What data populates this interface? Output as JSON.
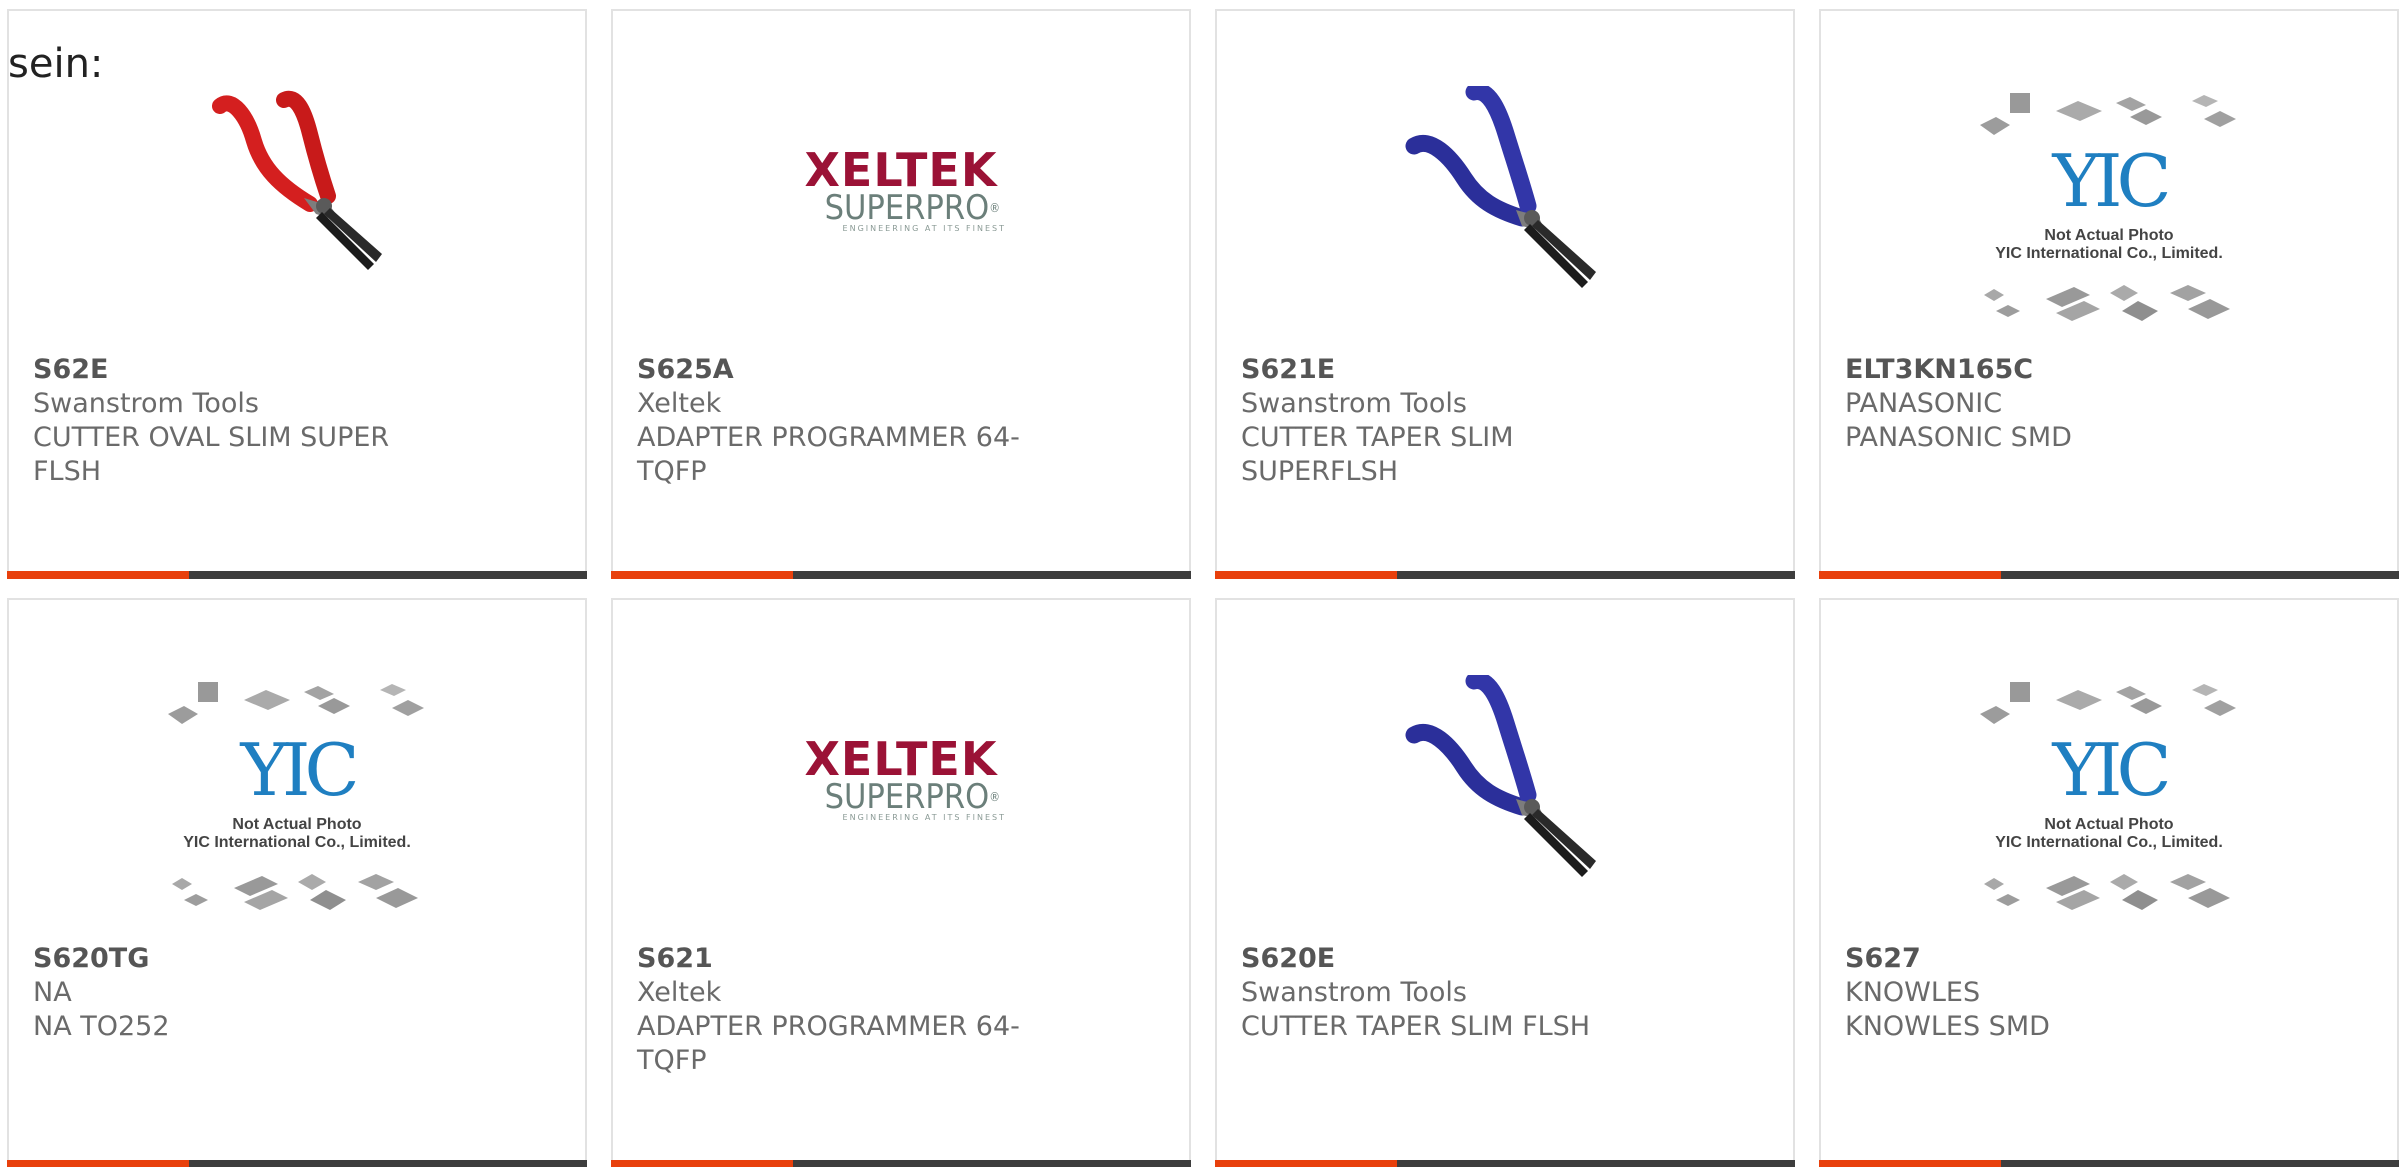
{
  "lead_text": "sein:",
  "colors": {
    "accent": "#e8400c",
    "bar": "#3d3d3d",
    "red_handle": "#d41f1f",
    "blue_handle": "#2b2f9a",
    "xeltek_red": "#9b1236",
    "yic_blue": "#1f7fc1"
  },
  "products": [
    {
      "part": "S62E",
      "maker": "Swanstrom Tools",
      "desc": "CUTTER OVAL SLIM SUPER FLSH",
      "image": "red-cutter-icon"
    },
    {
      "part": "S625A",
      "maker": "Xeltek",
      "desc": "ADAPTER PROGRAMMER 64-TQFP",
      "image": "xeltek-logo"
    },
    {
      "part": "S621E",
      "maker": "Swanstrom Tools",
      "desc": "CUTTER TAPER SLIM SUPERFLSH",
      "image": "blue-cutter-icon"
    },
    {
      "part": "ELT3KN165C",
      "maker": "PANASONIC",
      "desc": "PANASONIC SMD",
      "image": "yic-placeholder"
    },
    {
      "part": "S620TG",
      "maker": "NA",
      "desc": "NA TO252",
      "image": "yic-placeholder"
    },
    {
      "part": "S621",
      "maker": "Xeltek",
      "desc": "ADAPTER PROGRAMMER 64-TQFP",
      "image": "xeltek-logo"
    },
    {
      "part": "S620E",
      "maker": "Swanstrom Tools",
      "desc": "CUTTER TAPER SLIM FLSH",
      "image": "blue-cutter-icon"
    },
    {
      "part": "S627",
      "maker": "KNOWLES",
      "desc": "KNOWLES SMD",
      "image": "yic-placeholder"
    }
  ],
  "xeltek_logo": {
    "word": "XELTEK",
    "sub": "SUPERPRO",
    "reg": "®",
    "tagline": "ENGINEERING AT ITS FINEST"
  },
  "yic_placeholder": {
    "logo": "YIC",
    "line1": "Not Actual Photo",
    "line2": "YIC International Co., Limited."
  }
}
